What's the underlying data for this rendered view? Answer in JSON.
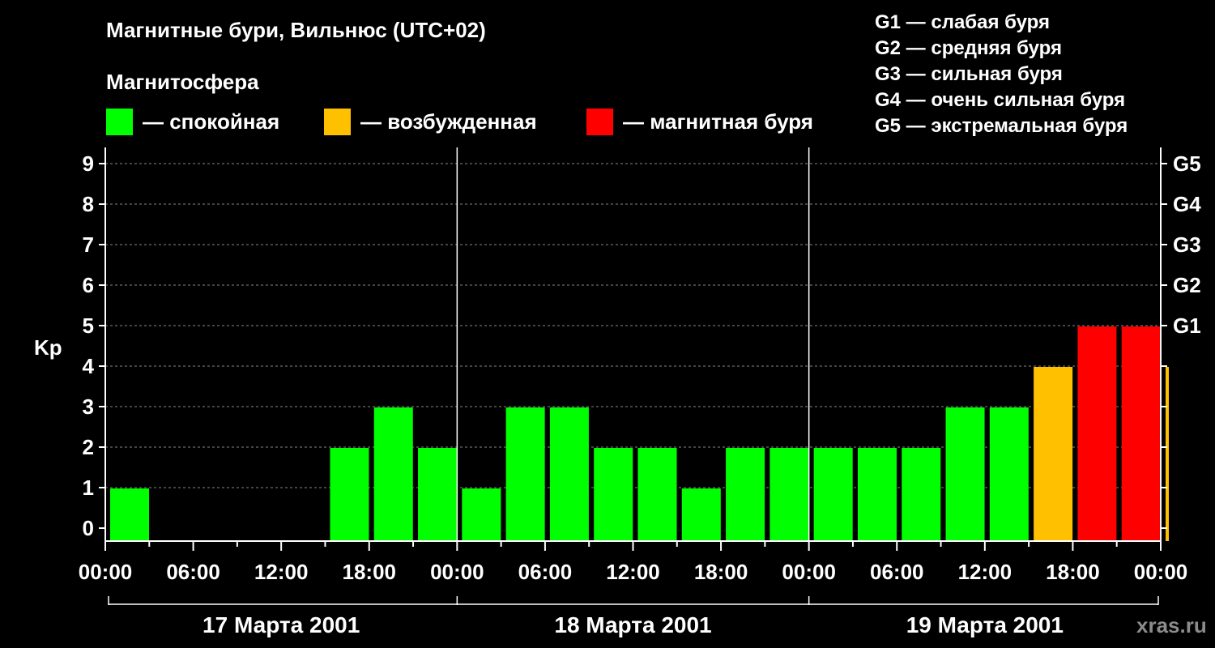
{
  "title": "Магнитные бури, Вильнюс (UTC+02)",
  "subtitle": "Магнитосфера",
  "legend": [
    {
      "label": "— спокойная",
      "color": "#00ff00"
    },
    {
      "label": "— возбужденная",
      "color": "#ffc000"
    },
    {
      "label": "— магнитная буря",
      "color": "#ff0000"
    }
  ],
  "storm_scale": [
    "G1 — слабая буря",
    "G2 — средняя буря",
    "G3 — сильная буря",
    "G4 — очень сильная буря",
    "G5 — экстремальная буря"
  ],
  "watermark": "xras.ru",
  "chart_data": {
    "type": "bar",
    "ylabel": "Kp",
    "ylim": [
      0,
      9
    ],
    "yticks": [
      "0",
      "1",
      "2",
      "3",
      "4",
      "5",
      "6",
      "7",
      "8",
      "9"
    ],
    "right_ticks": [
      "G1",
      "G2",
      "G3",
      "G4",
      "G5"
    ],
    "right_tick_values": [
      5,
      6,
      7,
      8,
      9
    ],
    "xticks": [
      "00:00",
      "06:00",
      "12:00",
      "18:00",
      "00:00",
      "06:00",
      "12:00",
      "18:00",
      "00:00",
      "06:00",
      "12:00",
      "18:00",
      "00:00"
    ],
    "days": [
      "17 Марта 2001",
      "18 Марта 2001",
      "19 Марта 2001"
    ],
    "bin_hours": 3,
    "values": [
      1,
      0,
      0,
      0,
      0,
      2,
      3,
      2,
      1,
      3,
      3,
      2,
      2,
      1,
      2,
      2,
      2,
      2,
      2,
      3,
      3,
      4,
      5,
      5,
      4
    ],
    "partial_last_bar": true,
    "colors": {
      "quiet": "#00ff00",
      "active": "#ffc000",
      "storm": "#ff0000"
    },
    "grid": "dashed horizontal"
  }
}
